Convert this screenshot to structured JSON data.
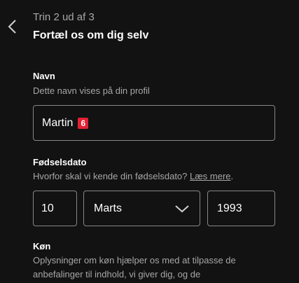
{
  "header": {
    "step_text": "Trin 2 ud af 3",
    "title": "Fortæl os om dig selv"
  },
  "name": {
    "label": "Navn",
    "hint": "Dette navn vises på din profil",
    "value": "Martin",
    "badge": "6"
  },
  "birthdate": {
    "label": "Fødselsdato",
    "hint": "Hvorfor skal vi kende din fødselsdato?",
    "link": "Læs mere",
    "hint_end": ".",
    "day": "10",
    "month": "Marts",
    "year": "1993"
  },
  "gender": {
    "label": "Køn",
    "description": "Oplysninger om køn hjælper os med at tilpasse de anbefalinger til indhold, vi giver dig, og de"
  },
  "icons": {
    "back": "chevron-left-icon",
    "dropdown": "chevron-down-icon"
  },
  "colors": {
    "background": "#121212",
    "text": "#ffffff",
    "muted_text": "#a7a7a7",
    "border": "#878787",
    "badge": "#e22134"
  }
}
